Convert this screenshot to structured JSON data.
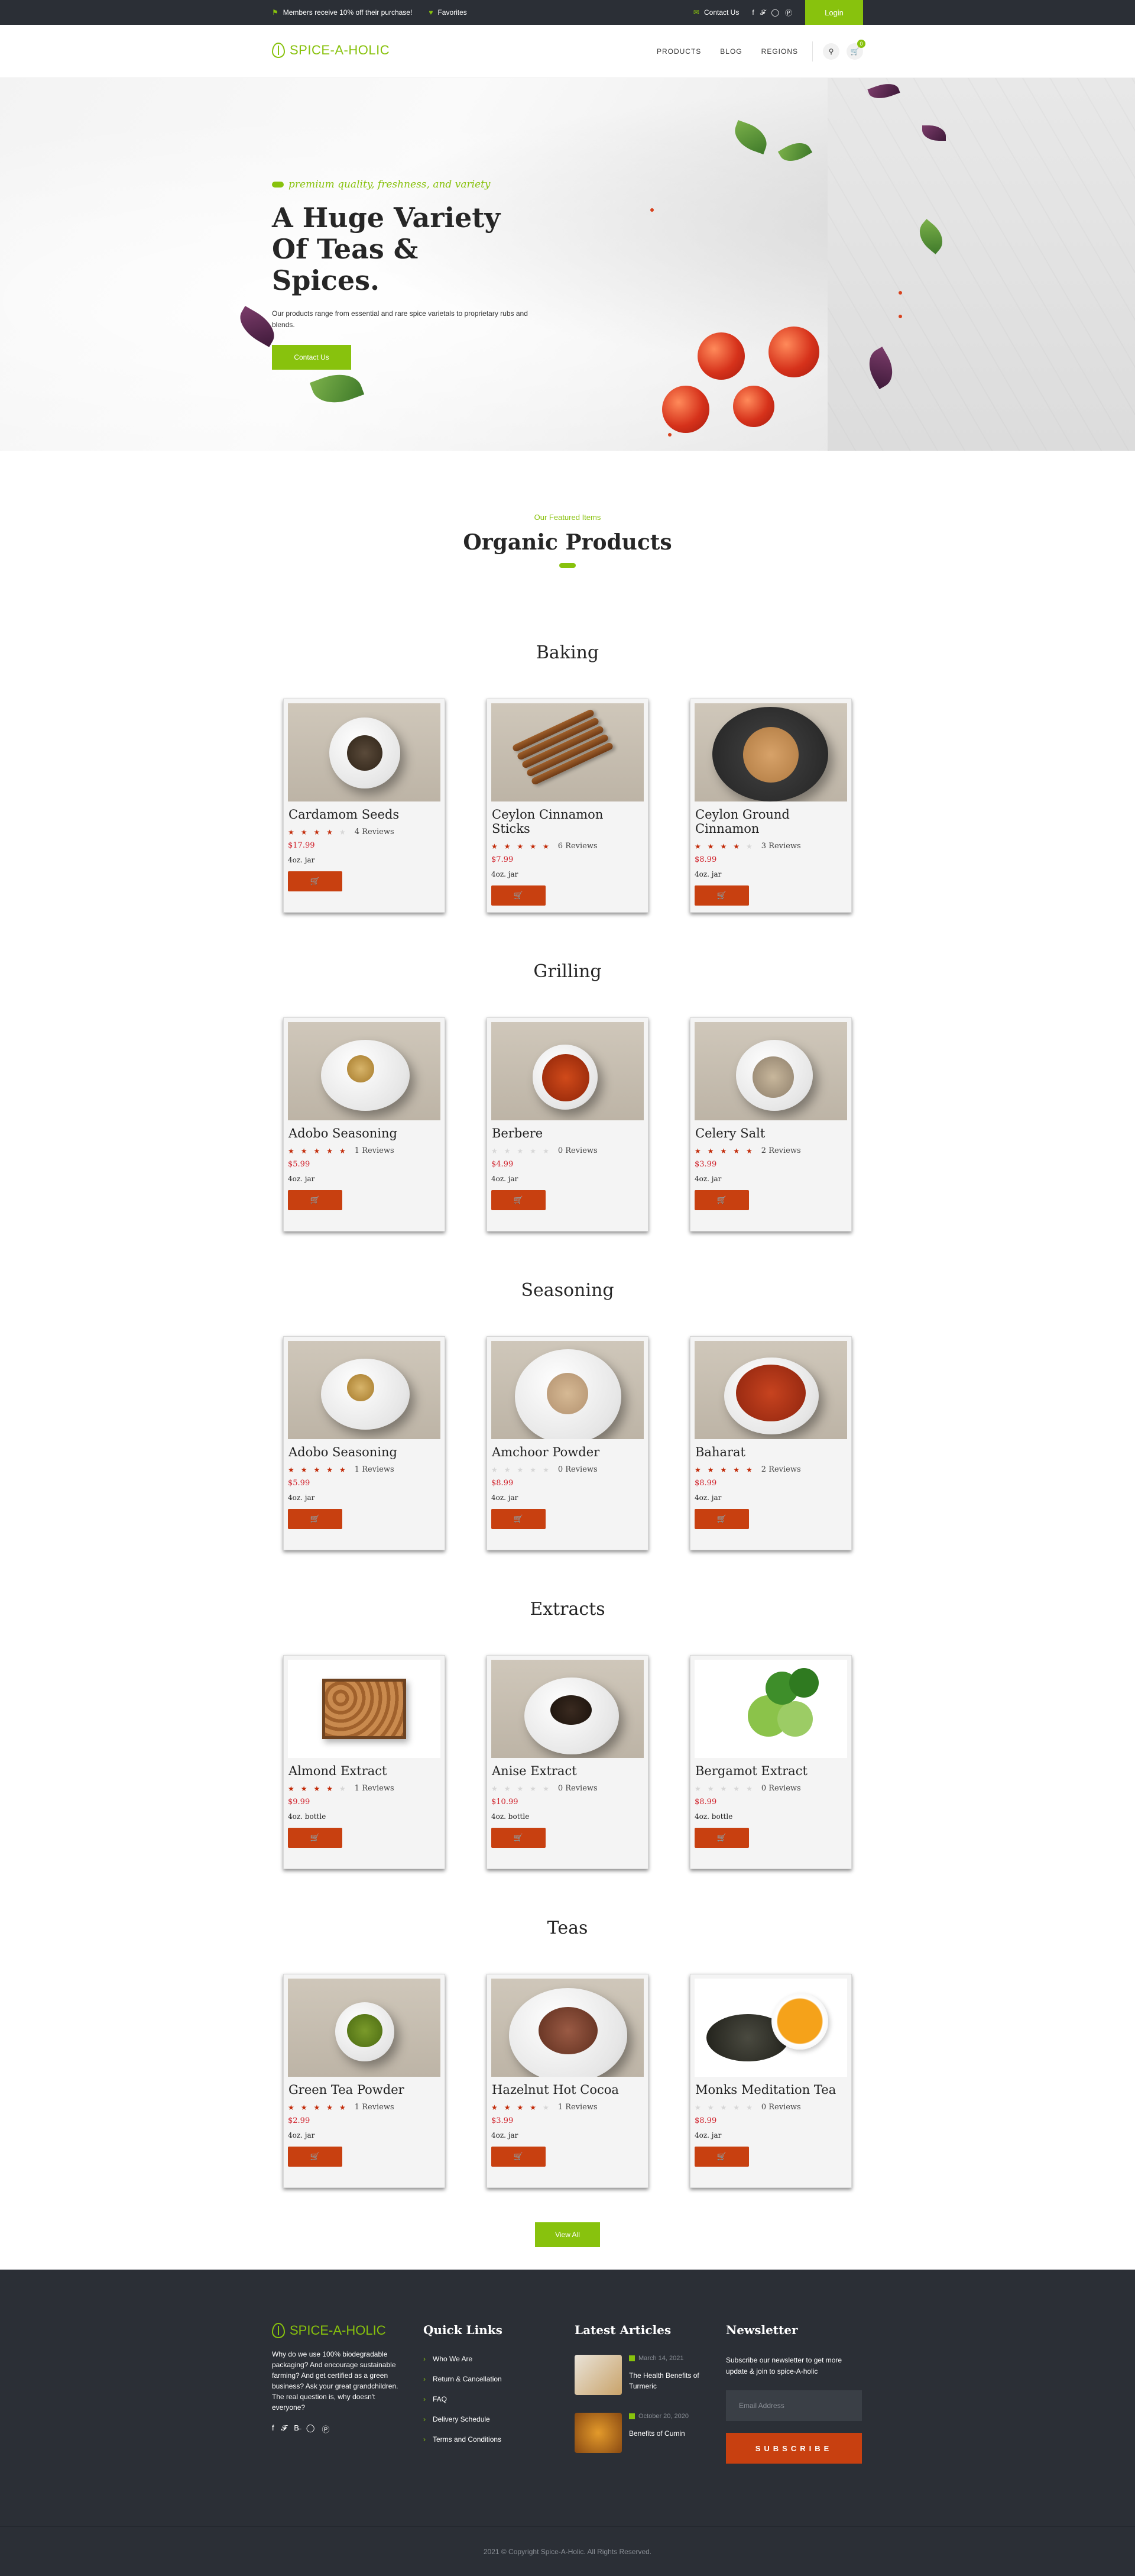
{
  "topbar": {
    "promo": "Members receive 10% off their purchase!",
    "favorites": "Favorites",
    "contact": "Contact Us",
    "login": "Login",
    "social": [
      "facebook-icon",
      "twitter-icon",
      "instagram-icon",
      "pinterest-icon"
    ]
  },
  "brand": {
    "name": "SPICE-A-HOLIC",
    "color": "#88c20d",
    "accent": "#c84010"
  },
  "nav": {
    "items": [
      "PRODUCTS",
      "BLOG",
      "REGIONS"
    ],
    "cart_count": "0"
  },
  "hero": {
    "tagline": "premium quality, freshness, and variety",
    "title": "A Huge Variety Of Teas & Spices.",
    "text": "Our products range from essential and rare spice varietals to proprietary rubs and blends.",
    "button": "Contact Us"
  },
  "featured": {
    "subtitle": "Our Featured Items",
    "title": "Organic Products"
  },
  "categories": [
    {
      "name": "Baking",
      "products": [
        {
          "name": "Cardamom Seeds",
          "stars": 4,
          "reviews": "4 Reviews",
          "price": "$17.99",
          "size": "4oz. jar"
        },
        {
          "name": "Ceylon Cinnamon Sticks",
          "stars": 5,
          "reviews": "6 Reviews",
          "price": "$7.99",
          "size": "4oz. jar"
        },
        {
          "name": "Ceylon Ground Cinnamon",
          "stars": 4,
          "reviews": "3 Reviews",
          "price": "$8.99",
          "size": "4oz. jar"
        }
      ]
    },
    {
      "name": "Grilling",
      "products": [
        {
          "name": "Adobo Seasoning",
          "stars": 5,
          "reviews": "1 Reviews",
          "price": "$5.99",
          "size": "4oz. jar"
        },
        {
          "name": "Berbere",
          "stars": 0,
          "reviews": "0 Reviews",
          "price": "$4.99",
          "size": "4oz. jar"
        },
        {
          "name": "Celery Salt",
          "stars": 4.5,
          "reviews": "2 Reviews",
          "price": "$3.99",
          "size": "4oz. jar"
        }
      ]
    },
    {
      "name": "Seasoning",
      "products": [
        {
          "name": "Adobo Seasoning",
          "stars": 5,
          "reviews": "1 Reviews",
          "price": "$5.99",
          "size": "4oz. jar"
        },
        {
          "name": "Amchoor Powder",
          "stars": 0,
          "reviews": "0 Reviews",
          "price": "$8.99",
          "size": "4oz. jar"
        },
        {
          "name": "Baharat",
          "stars": 5,
          "reviews": "2 Reviews",
          "price": "$8.99",
          "size": "4oz. jar"
        }
      ]
    },
    {
      "name": "Extracts",
      "products": [
        {
          "name": "Almond Extract",
          "stars": 4,
          "reviews": "1 Reviews",
          "price": "$9.99",
          "size": "4oz. bottle"
        },
        {
          "name": "Anise Extract",
          "stars": 0,
          "reviews": "0 Reviews",
          "price": "$10.99",
          "size": "4oz. bottle"
        },
        {
          "name": "Bergamot Extract",
          "stars": 0,
          "reviews": "0 Reviews",
          "price": "$8.99",
          "size": "4oz. bottle"
        }
      ]
    },
    {
      "name": "Teas",
      "products": [
        {
          "name": "Green Tea Powder",
          "stars": 5,
          "reviews": "1 Reviews",
          "price": "$2.99",
          "size": "4oz. jar"
        },
        {
          "name": "Hazelnut Hot Cocoa",
          "stars": 4,
          "reviews": "1 Reviews",
          "price": "$3.99",
          "size": "4oz. jar"
        },
        {
          "name": "Monks Meditation Tea",
          "stars": 0,
          "reviews": "0 Reviews",
          "price": "$8.99",
          "size": "4oz. jar"
        }
      ]
    }
  ],
  "view_all": "View All",
  "footer": {
    "about": "Why do we use 100% biodegradable packaging? And encourage sustainable farming? And get certified as a green business? Ask your great grandchildren. The real question is, why doesn't everyone?",
    "social": [
      "facebook-icon",
      "twitter-icon",
      "behance-icon",
      "instagram-icon",
      "pinterest-icon"
    ],
    "quick_links_title": "Quick Links",
    "quick_links": [
      "Who We Are",
      "Return & Cancellation",
      "FAQ",
      "Delivery Schedule",
      "Terms and Conditions"
    ],
    "articles_title": "Latest Articles",
    "articles": [
      {
        "date": "March 14, 2021",
        "title": "The Health Benefits of Turmeric"
      },
      {
        "date": "October 20, 2020",
        "title": "Benefits of Cumin"
      }
    ],
    "newsletter_title": "Newsletter",
    "newsletter_text": "Subscribe our newsletter to get more update & join to spice-A-holic",
    "email_placeholder": "Email Address",
    "subscribe": "SUBSCRIBE",
    "copyright": "2021 © Copyright Spice-A-Holic. All Rights Reserved."
  }
}
